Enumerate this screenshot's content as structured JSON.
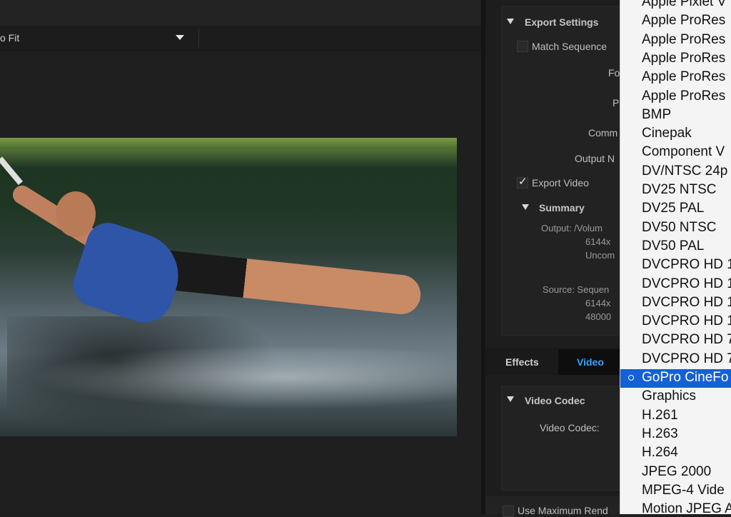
{
  "preview": {
    "fit_label": "o Fit"
  },
  "export_settings": {
    "section_title": "Export Settings",
    "match_sequence_label": "Match Sequence",
    "format_label": "Fo",
    "preset_label": "P",
    "comments_label": "Comm",
    "output_name_label": "Output N",
    "export_video_label": "Export Video",
    "export_video_checked": "✓",
    "summary_title": "Summary",
    "output_lines": [
      "Output: /Volum",
      "6144x",
      "Uncom"
    ],
    "source_lines": [
      "Source: Sequen",
      "6144x",
      "48000"
    ]
  },
  "tabs": {
    "effects": "Effects",
    "video": "Video"
  },
  "video_codec": {
    "section_title": "Video Codec",
    "codec_label": "Video Codec:"
  },
  "bottom": {
    "use_max_render": "Use Maximum Rend"
  },
  "codec_menu": {
    "selected_index": 20,
    "items": [
      "Apple Pixlet V",
      "Apple ProRes",
      "Apple ProRes",
      "Apple ProRes",
      "Apple ProRes",
      "Apple ProRes",
      "BMP",
      "Cinepak",
      "Component V",
      "DV/NTSC 24p",
      "DV25 NTSC",
      "DV25 PAL",
      "DV50 NTSC",
      "DV50 PAL",
      "DVCPRO HD 1",
      "DVCPRO HD 1",
      "DVCPRO HD 1",
      "DVCPRO HD 1",
      "DVCPRO HD 7",
      "DVCPRO HD 7",
      "GoPro CineFo",
      "Graphics",
      "H.261",
      "H.263",
      "H.264",
      "JPEG 2000",
      "MPEG-4 Vide",
      "Motion JPEG A"
    ]
  }
}
